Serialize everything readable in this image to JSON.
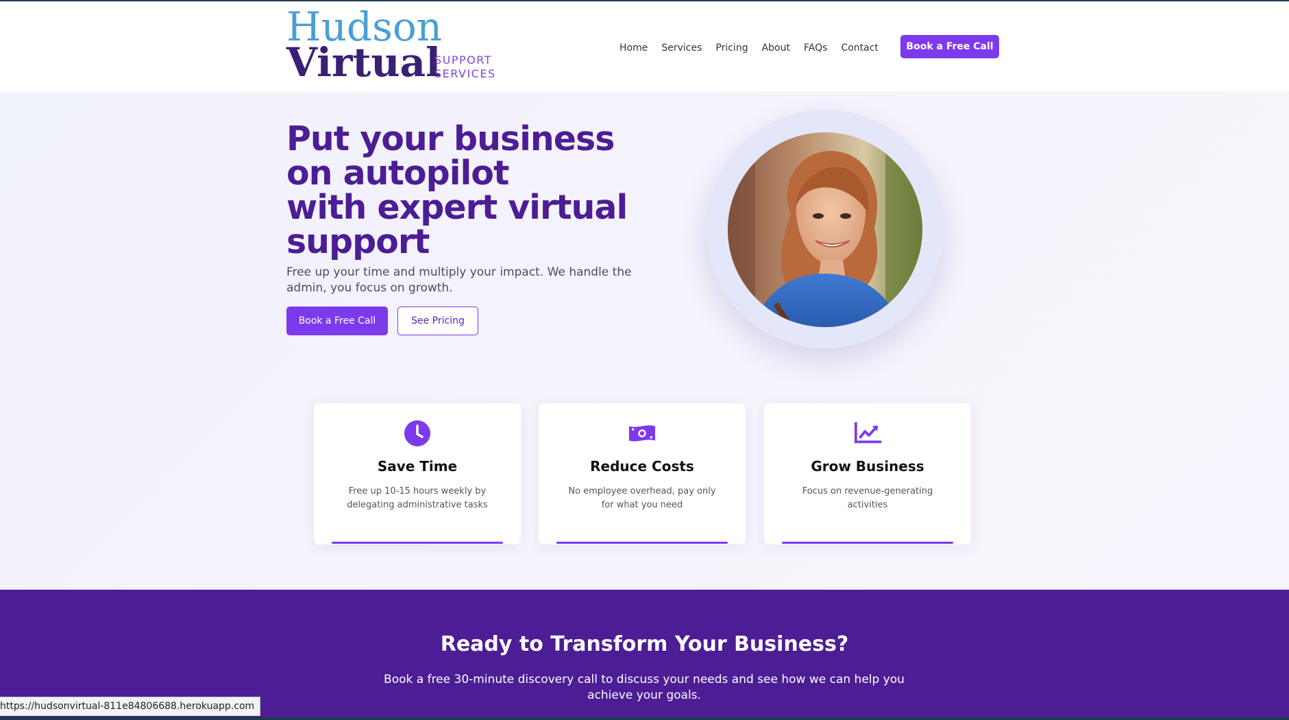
{
  "logo": {
    "line1": "Hudson",
    "line2": "Virtual",
    "tag1": "SUPPORT",
    "tag2": "SERVICES"
  },
  "nav": {
    "items": [
      "Home",
      "Services",
      "Pricing",
      "About",
      "FAQs",
      "Contact"
    ],
    "cta": "Book a Free Call"
  },
  "hero": {
    "title_lines": [
      "Put your business",
      "on autopilot",
      "with expert virtual",
      "support"
    ],
    "subtitle": "Free up your time and multiply your impact. We handle the admin, you focus on growth.",
    "primary_button": "Book a Free Call",
    "secondary_button": "See Pricing"
  },
  "cards": [
    {
      "icon": "clock-icon",
      "title": "Save Time",
      "desc": "Free up 10-15 hours weekly by delegating administrative tasks"
    },
    {
      "icon": "money-bill-icon",
      "title": "Reduce Costs",
      "desc": "No employee overhead, pay only for what you need"
    },
    {
      "icon": "chart-line-icon",
      "title": "Grow Business",
      "desc": "Focus on revenue-generating activities"
    }
  ],
  "cta": {
    "title": "Ready to Transform Your Business?",
    "subtitle": "Book a free 30-minute discovery call to discuss your needs and see how we can help you achieve your goals."
  },
  "status_url": "https://hudsonvirtual-811e84806688.herokuapp.com",
  "colors": {
    "brand_purple": "#7c3aed",
    "heading_purple": "#4c1d95",
    "logo_blue": "#4a9fd6"
  }
}
